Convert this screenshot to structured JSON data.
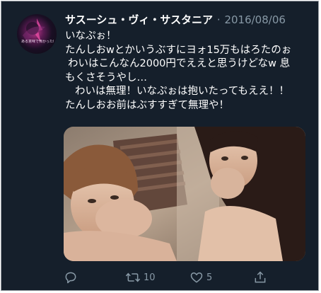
{
  "tweet": {
    "display_name": "サスーシュ・ヴィ・サスタニア",
    "separator": "·",
    "date": "2016/08/06",
    "avatar_caption": "ある意味で怖かった戦争",
    "lines": [
      "いなぷぉ！",
      "たんしおwとかいうぶすにヨォ15万もはろたのぉ",
      "わいはこんなん2000円でええと思うけどなw 息",
      "もくさそうやし…",
      "わいは無理！いなぷぉは抱いたってもええ！！",
      "たんしおお前はぶすすぎて無理や！"
    ]
  },
  "actions": {
    "reply": {
      "icon": "reply-icon",
      "count": ""
    },
    "retweet": {
      "icon": "retweet-icon",
      "count": "10"
    },
    "like": {
      "icon": "heart-icon",
      "count": "5"
    },
    "share": {
      "icon": "share-icon",
      "count": ""
    }
  },
  "colors": {
    "background": "#151f2b",
    "text": "#ffffff",
    "muted": "#8899a6"
  }
}
